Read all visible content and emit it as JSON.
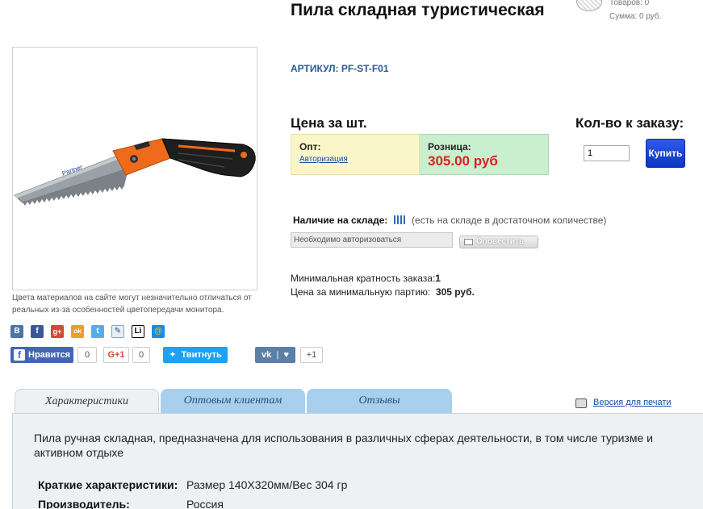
{
  "product": {
    "title": "Пила складная туристическая",
    "article": "АРТИКУЛ: PF-ST-F01",
    "image_note": "Цвета материалов на сайте могут незначительно отличаться от реальных из-за особенностей цветопередачи монитора."
  },
  "cart": {
    "items": "Товаров: 0",
    "sum": "Сумма: 0 руб."
  },
  "pricing": {
    "header": "Цена за шт.",
    "opt_label": "Опт:",
    "opt_link": "Авторизация",
    "retail_label": "Розница:",
    "retail_value": "305.00 руб"
  },
  "order": {
    "header": "Кол-во к заказу:",
    "quantity": "1",
    "buy_label": "Купить"
  },
  "stock": {
    "label": "Наличие на складе:",
    "note": "(есть на складе в достаточном количестве)",
    "auth_placeholder": "Необходимо авторизоваться",
    "notify_label": "Оповестить"
  },
  "min_order": {
    "multiplicity_label": "Минимальная кратность заказа:",
    "multiplicity_value": "1",
    "batch_label": "Цена за минимальную партию:",
    "batch_value": "305 руб."
  },
  "share_icons": [
    {
      "name": "vkontakte-icon",
      "glyph": "B",
      "color": "#4c75a3"
    },
    {
      "name": "facebook-icon",
      "glyph": "f",
      "color": "#3b5998"
    },
    {
      "name": "google-plus-icon",
      "glyph": "g+",
      "color": "#d34836"
    },
    {
      "name": "odnoklassniki-icon",
      "glyph": "ok",
      "color": "#f29b2b"
    },
    {
      "name": "twitter-icon",
      "glyph": "t",
      "color": "#55acee"
    },
    {
      "name": "livejournal-icon",
      "glyph": "✎",
      "color": "#e7eef6"
    },
    {
      "name": "liveinternet-icon",
      "glyph": "Li",
      "color": "#ffffff"
    },
    {
      "name": "mail-ru-icon",
      "glyph": "@",
      "color": "#168de2"
    }
  ],
  "social": {
    "fb_like": "Нравится",
    "fb_count": "0",
    "gplus_label": "G+1",
    "gplus_count": "0",
    "tweet": "Твитнуть",
    "vk_label": "vk",
    "vk_count": "+1"
  },
  "tabs": [
    "Характеристики",
    "Оптовым клиентам",
    "Отзывы"
  ],
  "print_version": "Версия для печати",
  "description": "Пила ручная складная, предназначена для использования в различных сферах деятельности, в том числе туризме и активном отдыхе",
  "specs": [
    {
      "label": "Краткие характеристики:",
      "value": "Размер 140X320мм/Вес 304 гр"
    },
    {
      "label": "Производитель:",
      "value": "Россия"
    }
  ]
}
